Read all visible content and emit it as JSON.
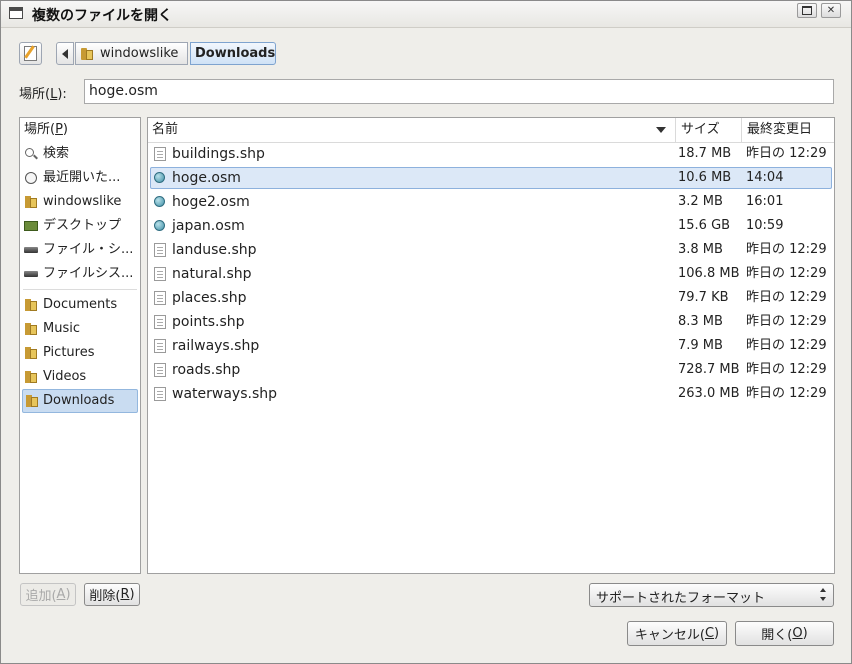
{
  "window": {
    "title": "複数のファイルを開く",
    "accent": "#c9dcf1"
  },
  "pathbar": {
    "crumbs": [
      {
        "label": "windowslike",
        "icon": "home-folder-icon"
      },
      {
        "label": "Downloads",
        "icon": "downloads-folder-icon",
        "active": true
      }
    ]
  },
  "location": {
    "label_prefix": "場所(",
    "label_key": "L",
    "label_suffix": "):",
    "value": "hoge.osm"
  },
  "places": {
    "header_prefix": "場所(",
    "header_key": "P",
    "header_suffix": ")",
    "items": [
      {
        "label": "検索",
        "icon": "search-icon"
      },
      {
        "label": "最近開いた...",
        "icon": "recent-icon"
      },
      {
        "label": "windowslike",
        "icon": "home-folder-icon"
      },
      {
        "label": "デスクトップ",
        "icon": "desktop-icon"
      },
      {
        "label": "ファイル・シ...",
        "icon": "drive-icon"
      },
      {
        "label": "ファイルシス...",
        "icon": "drive-icon"
      },
      {
        "label": "Documents",
        "icon": "folder-icon"
      },
      {
        "label": "Music",
        "icon": "folder-icon"
      },
      {
        "label": "Pictures",
        "icon": "folder-icon"
      },
      {
        "label": "Videos",
        "icon": "folder-icon"
      },
      {
        "label": "Downloads",
        "icon": "folder-icon",
        "selected": true
      }
    ]
  },
  "files": {
    "columns": {
      "name": "名前",
      "size": "サイズ",
      "modified": "最終変更日"
    },
    "rows": [
      {
        "name": "buildings.shp",
        "size": "18.7 MB",
        "modified": "昨日の 12:29",
        "icon": "document-icon"
      },
      {
        "name": "hoge.osm",
        "size": "10.6 MB",
        "modified": "14:04",
        "icon": "osm-file-icon",
        "selected": true
      },
      {
        "name": "hoge2.osm",
        "size": "3.2 MB",
        "modified": "16:01",
        "icon": "osm-file-icon"
      },
      {
        "name": "japan.osm",
        "size": "15.6 GB",
        "modified": "10:59",
        "icon": "osm-file-icon"
      },
      {
        "name": "landuse.shp",
        "size": "3.8 MB",
        "modified": "昨日の 12:29",
        "icon": "document-icon"
      },
      {
        "name": "natural.shp",
        "size": "106.8 MB",
        "modified": "昨日の 12:29",
        "icon": "document-icon"
      },
      {
        "name": "places.shp",
        "size": "79.7 KB",
        "modified": "昨日の 12:29",
        "icon": "document-icon"
      },
      {
        "name": "points.shp",
        "size": "8.3 MB",
        "modified": "昨日の 12:29",
        "icon": "document-icon"
      },
      {
        "name": "railways.shp",
        "size": "7.9 MB",
        "modified": "昨日の 12:29",
        "icon": "document-icon"
      },
      {
        "name": "roads.shp",
        "size": "728.7 MB",
        "modified": "昨日の 12:29",
        "icon": "document-icon"
      },
      {
        "name": "waterways.shp",
        "size": "263.0 MB",
        "modified": "昨日の 12:29",
        "icon": "document-icon"
      }
    ]
  },
  "buttons": {
    "add": {
      "prefix": "追加(",
      "key": "A",
      "suffix": ")"
    },
    "remove": {
      "prefix": "削除(",
      "key": "R",
      "suffix": ")"
    },
    "cancel": {
      "prefix": "キャンセル(",
      "key": "C",
      "suffix": ")"
    },
    "open": {
      "prefix": "開く(",
      "key": "O",
      "suffix": ")"
    }
  },
  "filter": {
    "selected": "サポートされたフォーマット"
  }
}
